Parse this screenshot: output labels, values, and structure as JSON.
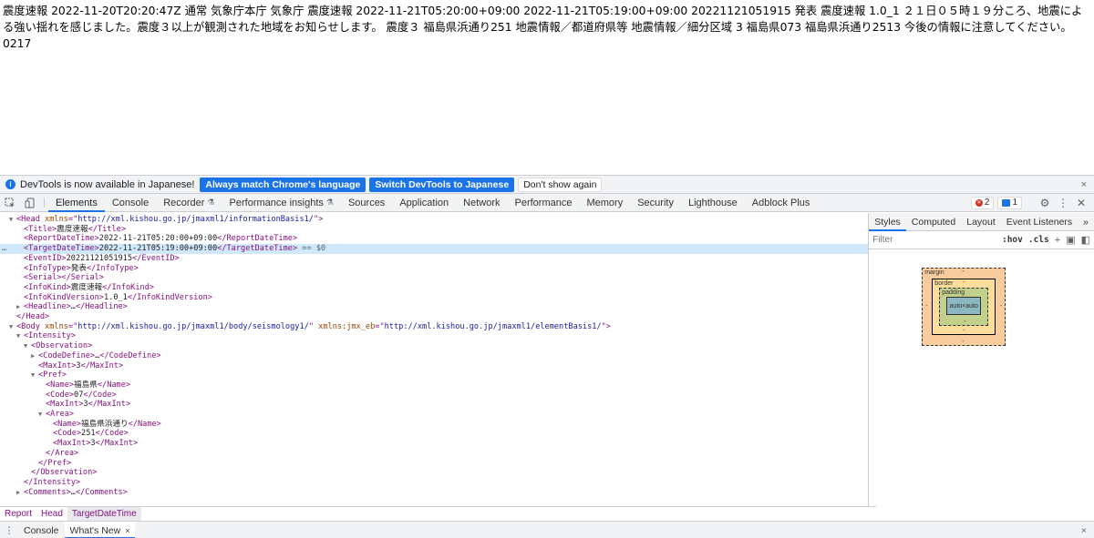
{
  "page": {
    "text": "震度速報 2022-11-20T20:20:47Z 通常 気象庁本庁 気象庁 震度速報 2022-11-21T05:20:00+09:00 2022-11-21T05:19:00+09:00 20221121051915 発表 震度速報 1.0_1 ２１日０５時１９分ころ、地震による強い揺れを感じました。震度３以上が観測された地域をお知らせします。 震度３ 福島県浜通り251 地震情報／都道府県等 地震情報／細分区域 3 福島県073 福島県浜通り2513 今後の情報に注意してください。 0217"
  },
  "infobar": {
    "icon": "info-icon",
    "message": "DevTools is now available in Japanese!",
    "btn_match": "Always match Chrome's language",
    "btn_switch": "Switch DevTools to Japanese",
    "btn_dismiss": "Don't show again",
    "close": "×"
  },
  "tabs": {
    "elements": "Elements",
    "console": "Console",
    "recorder": "Recorder",
    "perf_insights": "Performance insights",
    "sources": "Sources",
    "application": "Application",
    "network": "Network",
    "performance": "Performance",
    "memory": "Memory",
    "security": "Security",
    "lighthouse": "Lighthouse",
    "adblock": "Adblock Plus",
    "flask": "⚗",
    "error_count": "2",
    "message_count": "1"
  },
  "tree": [
    {
      "indent": 0,
      "arrow": "▼",
      "parts": [
        [
          "tag",
          "<Head "
        ],
        [
          "attr",
          "xmlns"
        ],
        [
          "tag",
          "=\""
        ],
        [
          "val",
          "http://xml.kishou.go.jp/jmaxml1/informationBasis1/"
        ],
        [
          "tag",
          "\">"
        ]
      ]
    },
    {
      "indent": 1,
      "arrow": "",
      "parts": [
        [
          "tag",
          "<Title>"
        ],
        [
          "text",
          "震度速報"
        ],
        [
          "tag",
          "</Title>"
        ]
      ]
    },
    {
      "indent": 1,
      "arrow": "",
      "parts": [
        [
          "tag",
          "<ReportDateTime>"
        ],
        [
          "text",
          "2022-11-21T05:20:00+09:00"
        ],
        [
          "tag",
          "</ReportDateTime>"
        ]
      ]
    },
    {
      "indent": 1,
      "arrow": "",
      "selected": true,
      "parts": [
        [
          "tag",
          "<TargetDateTime>"
        ],
        [
          "text",
          "2022-11-21T05:19:00+09:00"
        ],
        [
          "tag",
          "</TargetDateTime>"
        ],
        [
          "eq",
          " == $0"
        ]
      ]
    },
    {
      "indent": 1,
      "arrow": "",
      "parts": [
        [
          "tag",
          "<EventID>"
        ],
        [
          "text",
          "20221121051915"
        ],
        [
          "tag",
          "</EventID>"
        ]
      ]
    },
    {
      "indent": 1,
      "arrow": "",
      "parts": [
        [
          "tag",
          "<InfoType>"
        ],
        [
          "text",
          "発表"
        ],
        [
          "tag",
          "</InfoType>"
        ]
      ]
    },
    {
      "indent": 1,
      "arrow": "",
      "parts": [
        [
          "tag",
          "<Serial></Serial>"
        ]
      ]
    },
    {
      "indent": 1,
      "arrow": "",
      "parts": [
        [
          "tag",
          "<InfoKind>"
        ],
        [
          "text",
          "震度速報"
        ],
        [
          "tag",
          "</InfoKind>"
        ]
      ]
    },
    {
      "indent": 1,
      "arrow": "",
      "parts": [
        [
          "tag",
          "<InfoKindVersion>"
        ],
        [
          "text",
          "1.0_1"
        ],
        [
          "tag",
          "</InfoKindVersion>"
        ]
      ]
    },
    {
      "indent": 1,
      "arrow": "▶",
      "parts": [
        [
          "tag",
          "<Headline>"
        ],
        [
          "text",
          "…"
        ],
        [
          "tag",
          "</Headline>"
        ]
      ]
    },
    {
      "indent": 0,
      "arrow": "",
      "parts": [
        [
          "tag",
          "</Head>"
        ]
      ]
    },
    {
      "indent": 0,
      "arrow": "▼",
      "parts": [
        [
          "tag",
          "<Body "
        ],
        [
          "attr",
          "xmlns"
        ],
        [
          "tag",
          "=\""
        ],
        [
          "val",
          "http://xml.kishou.go.jp/jmaxml1/body/seismology1/"
        ],
        [
          "tag",
          "\" "
        ],
        [
          "attr",
          "xmlns:jmx_eb"
        ],
        [
          "tag",
          "=\""
        ],
        [
          "val",
          "http://xml.kishou.go.jp/jmaxml1/elementBasis1/"
        ],
        [
          "tag",
          "\">"
        ]
      ]
    },
    {
      "indent": 1,
      "arrow": "▼",
      "parts": [
        [
          "tag",
          "<Intensity>"
        ]
      ]
    },
    {
      "indent": 2,
      "arrow": "▼",
      "parts": [
        [
          "tag",
          "<Observation>"
        ]
      ]
    },
    {
      "indent": 3,
      "arrow": "▶",
      "parts": [
        [
          "tag",
          "<CodeDefine>"
        ],
        [
          "text",
          "…"
        ],
        [
          "tag",
          "</CodeDefine>"
        ]
      ]
    },
    {
      "indent": 3,
      "arrow": "",
      "parts": [
        [
          "tag",
          "<MaxInt>"
        ],
        [
          "text",
          "3"
        ],
        [
          "tag",
          "</MaxInt>"
        ]
      ]
    },
    {
      "indent": 3,
      "arrow": "▼",
      "parts": [
        [
          "tag",
          "<Pref>"
        ]
      ]
    },
    {
      "indent": 4,
      "arrow": "",
      "parts": [
        [
          "tag",
          "<Name>"
        ],
        [
          "text",
          "福島県"
        ],
        [
          "tag",
          "</Name>"
        ]
      ]
    },
    {
      "indent": 4,
      "arrow": "",
      "parts": [
        [
          "tag",
          "<Code>"
        ],
        [
          "text",
          "07"
        ],
        [
          "tag",
          "</Code>"
        ]
      ]
    },
    {
      "indent": 4,
      "arrow": "",
      "parts": [
        [
          "tag",
          "<MaxInt>"
        ],
        [
          "text",
          "3"
        ],
        [
          "tag",
          "</MaxInt>"
        ]
      ]
    },
    {
      "indent": 4,
      "arrow": "▼",
      "parts": [
        [
          "tag",
          "<Area>"
        ]
      ]
    },
    {
      "indent": 5,
      "arrow": "",
      "parts": [
        [
          "tag",
          "<Name>"
        ],
        [
          "text",
          "福島県浜通り"
        ],
        [
          "tag",
          "</Name>"
        ]
      ]
    },
    {
      "indent": 5,
      "arrow": "",
      "parts": [
        [
          "tag",
          "<Code>"
        ],
        [
          "text",
          "251"
        ],
        [
          "tag",
          "</Code>"
        ]
      ]
    },
    {
      "indent": 5,
      "arrow": "",
      "parts": [
        [
          "tag",
          "<MaxInt>"
        ],
        [
          "text",
          "3"
        ],
        [
          "tag",
          "</MaxInt>"
        ]
      ]
    },
    {
      "indent": 4,
      "arrow": "",
      "parts": [
        [
          "tag",
          "</Area>"
        ]
      ]
    },
    {
      "indent": 3,
      "arrow": "",
      "parts": [
        [
          "tag",
          "</Pref>"
        ]
      ]
    },
    {
      "indent": 2,
      "arrow": "",
      "parts": [
        [
          "tag",
          "</Observation>"
        ]
      ]
    },
    {
      "indent": 1,
      "arrow": "",
      "parts": [
        [
          "tag",
          "</Intensity>"
        ]
      ]
    },
    {
      "indent": 1,
      "arrow": "▶",
      "parts": [
        [
          "tag",
          "<Comments>"
        ],
        [
          "text",
          "…"
        ],
        [
          "tag",
          "</Comments>"
        ]
      ]
    }
  ],
  "styles": {
    "tabs": [
      "Styles",
      "Computed",
      "Layout",
      "Event Listeners"
    ],
    "more": "»",
    "filter_placeholder": "Filter",
    "hov": ":hov",
    "cls": ".cls",
    "plus": "+",
    "box": {
      "margin_label": "margin",
      "border_label": "border",
      "padding_label": "padding",
      "content": "auto×auto",
      "dash": "-"
    }
  },
  "breadcrumb": [
    "Report",
    "Head",
    "TargetDateTime"
  ],
  "drawer": {
    "menu": "⋮",
    "tab_console": "Console",
    "tab_whats_new": "What's New",
    "tab_close": "×",
    "close": "×"
  }
}
